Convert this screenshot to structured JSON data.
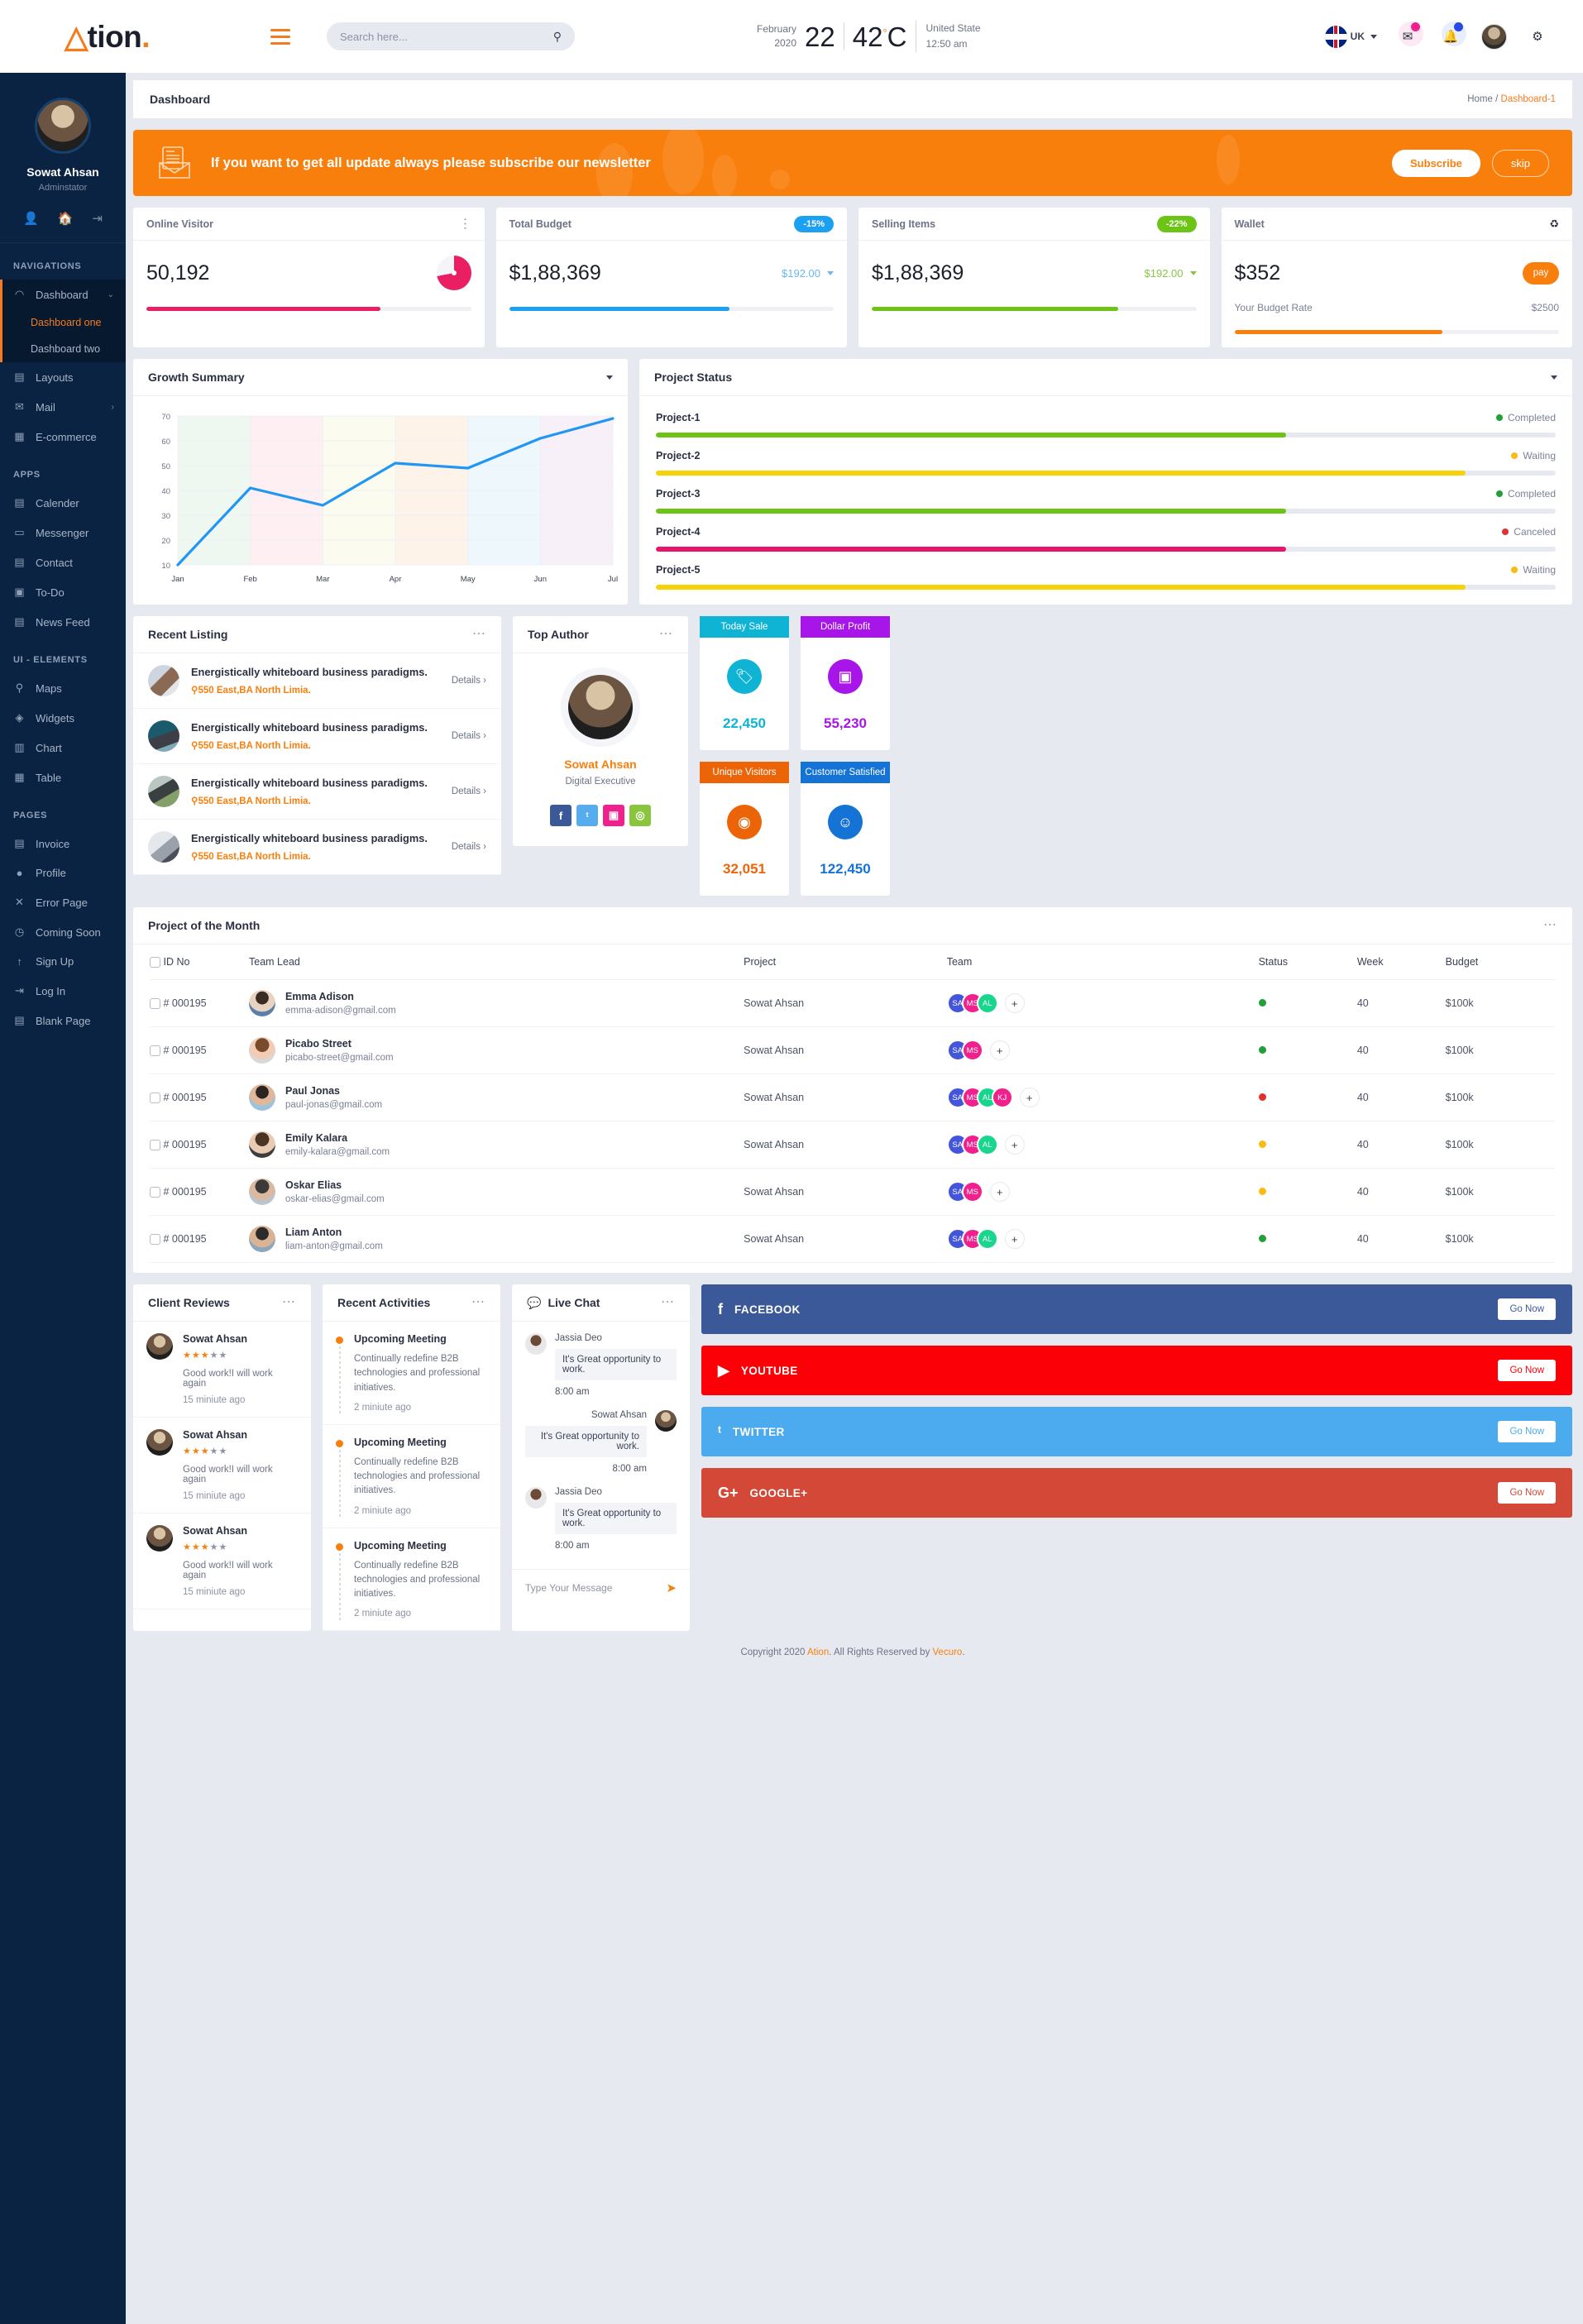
{
  "brand": {
    "mark": "A",
    "name": "tion",
    "dot": "."
  },
  "search": {
    "placeholder": "Search here...",
    "value": "",
    "icon": "search-icon"
  },
  "weather": {
    "month": "February",
    "year": "2020",
    "day": "22",
    "temp": "42",
    "unit": "C",
    "country": "United State",
    "time": "12:50 am"
  },
  "topbar": {
    "lang": "UK",
    "flag": "uk-flag-icon",
    "mail_icon": "mail-icon",
    "bell_icon": "bell-icon",
    "gear_icon": "gear-icon"
  },
  "profile": {
    "name": "Sowat Ahsan",
    "role": "Adminstator",
    "actions": [
      "user-icon",
      "home-icon",
      "logout-icon"
    ]
  },
  "sidebar": {
    "sections": [
      {
        "label": "NAVIGATIONS",
        "items": [
          {
            "label": "Dashboard",
            "icon": "speedometer-icon",
            "expandable": true,
            "open": true,
            "children": [
              {
                "label": "Dashboard one",
                "active": true
              },
              {
                "label": "Dashboard two",
                "active": false
              }
            ]
          },
          {
            "label": "Layouts",
            "icon": "grid-icon",
            "expandable": false
          },
          {
            "label": "Mail",
            "icon": "envelope-icon",
            "expandable": true
          },
          {
            "label": "E-commerce",
            "icon": "cart-icon",
            "expandable": false
          }
        ]
      },
      {
        "label": "APPS",
        "items": [
          {
            "label": "Calender",
            "icon": "calendar-icon"
          },
          {
            "label": "Messenger",
            "icon": "chat-icon"
          },
          {
            "label": "Contact",
            "icon": "contact-icon"
          },
          {
            "label": "To-Do",
            "icon": "todo-icon"
          },
          {
            "label": "News Feed",
            "icon": "news-icon"
          }
        ]
      },
      {
        "label": "UI - ELEMENTS",
        "items": [
          {
            "label": "Maps",
            "icon": "map-pin-icon"
          },
          {
            "label": "Widgets",
            "icon": "widget-icon"
          },
          {
            "label": "Chart",
            "icon": "chart-icon"
          },
          {
            "label": "Table",
            "icon": "table-icon"
          }
        ]
      },
      {
        "label": "PAGES",
        "items": [
          {
            "label": "Invoice",
            "icon": "invoice-icon"
          },
          {
            "label": "Profile",
            "icon": "person-icon"
          },
          {
            "label": "Error Page",
            "icon": "x-icon"
          },
          {
            "label": "Coming Soon",
            "icon": "clock-icon"
          },
          {
            "label": "Sign Up",
            "icon": "signup-icon"
          },
          {
            "label": "Log In",
            "icon": "login-icon"
          },
          {
            "label": "Blank Page",
            "icon": "page-icon"
          }
        ]
      }
    ]
  },
  "page": {
    "title": "Dashboard",
    "crumb_home": "Home",
    "crumb_sep": "/",
    "crumb_current": "Dashboard-1"
  },
  "banner": {
    "icon": "newsletter-envelope-icon",
    "text": "If you want to get all update always please subscribe our newsletter",
    "subscribe": "Subscribe",
    "skip": "skip",
    "color": "#f97f0d"
  },
  "stats": [
    {
      "title": "Online Visitor",
      "value": "50,192",
      "menu_icon": "kebab-menu-icon",
      "badge": null,
      "sub": null,
      "bar_pct": 72,
      "color": "#e91e63",
      "visual": "pie"
    },
    {
      "title": "Total Budget",
      "value": "$1,88,369",
      "badge": "-15%",
      "badge_color": "#1ca0f2",
      "sub": "$192.00",
      "sub_color": "#6ab7f5",
      "bar_pct": 68,
      "color": "#1ca0f2",
      "visual": "caret"
    },
    {
      "title": "Selling Items",
      "value": "$1,88,369",
      "badge": "-22%",
      "badge_color": "#6cc417",
      "sub": "$192.00",
      "sub_color": "#8bc34a",
      "bar_pct": 76,
      "color": "#6cc417",
      "visual": "caret"
    },
    {
      "title": "Wallet",
      "value": "$352",
      "menu_icon": "recycle-icon",
      "pay_label": "pay",
      "rate_label": "Your Budget Rate",
      "rate_value": "$2500",
      "bar_pct": 64,
      "color": "#f97f0d",
      "visual": "pay"
    }
  ],
  "chart_data": {
    "type": "line",
    "title": "Growth Summary",
    "x": [
      "Jan",
      "Feb",
      "Mar",
      "Apr",
      "May",
      "Jun",
      "Jul"
    ],
    "values": [
      10,
      41,
      34,
      51,
      49,
      61,
      69
    ],
    "ylim": [
      10,
      70
    ],
    "yticks": [
      10,
      20,
      30,
      40,
      50,
      60,
      70
    ],
    "xlabel": "",
    "ylabel": "",
    "line_color": "#2196f3",
    "grid": true,
    "legend": "none",
    "band_colors": [
      "#eef8f1",
      "#fdeff2",
      "#fbfbef",
      "#fdf3e9",
      "#eef7fb",
      "#f8f0f8"
    ]
  },
  "project_status": {
    "title": "Project Status",
    "items": [
      {
        "name": "Project-1",
        "status": "Completed",
        "color": "#6cc417",
        "dot": "#21a03a",
        "pct": 70
      },
      {
        "name": "Project-2",
        "status": "Waiting",
        "color": "#f6d307",
        "dot": "#f9bc13",
        "pct": 90
      },
      {
        "name": "Project-3",
        "status": "Completed",
        "color": "#6cc417",
        "dot": "#21a03a",
        "pct": 70
      },
      {
        "name": "Project-4",
        "status": "Canceled",
        "color": "#e9156b",
        "dot": "#e03131",
        "pct": 70
      },
      {
        "name": "Project-5",
        "status": "Waiting",
        "color": "#f6d307",
        "dot": "#f9bc13",
        "pct": 90
      }
    ]
  },
  "recent_listing": {
    "title": "Recent Listing",
    "menu_icon": "kebab-menu-icon",
    "items": [
      {
        "title": "Energistically whiteboard business paradigms.",
        "location": "550 East,BA North Limia.",
        "details": "Details",
        "thumb": "t1"
      },
      {
        "title": "Energistically whiteboard business paradigms.",
        "location": "550 East,BA North Limia.",
        "details": "Details",
        "thumb": "t2"
      },
      {
        "title": "Energistically whiteboard business paradigms.",
        "location": "550 East,BA North Limia.",
        "details": "Details",
        "thumb": "t3"
      },
      {
        "title": "Energistically whiteboard business paradigms.",
        "location": "550 East,BA North Limia.",
        "details": "Details",
        "thumb": "t4"
      }
    ]
  },
  "top_author": {
    "title": "Top Author",
    "menu_icon": "kebab-menu-icon",
    "name": "Sowat Ahsan",
    "role": "Digital Executive",
    "socials": [
      {
        "name": "facebook-icon",
        "glyph": "f",
        "color": "#3b5998"
      },
      {
        "name": "twitter-icon",
        "glyph": "ᵗ",
        "color": "#55acee"
      },
      {
        "name": "instagram-icon",
        "glyph": "▣",
        "color": "#f0208c"
      },
      {
        "name": "dribbble-icon",
        "glyph": "◎",
        "color": "#8ac53e"
      }
    ]
  },
  "tiles": [
    {
      "label": "Today Sale",
      "value": "22,450",
      "color": "#0fb4d4",
      "icon": "tag-icon"
    },
    {
      "label": "Dollar Profit",
      "value": "55,230",
      "color": "#a715e8",
      "icon": "money-icon"
    },
    {
      "label": "Unique Visitors",
      "value": "32,051",
      "color": "#ec6408",
      "icon": "eye-icon"
    },
    {
      "label": "Customer Satisfied",
      "value": "122,450",
      "color": "#1573d6",
      "icon": "smiley-icon"
    }
  ],
  "project_month": {
    "title": "Project of the Month",
    "menu_icon": "kebab-menu-icon",
    "columns": [
      "ID No",
      "Team Lead",
      "Project",
      "Team",
      "Status",
      "Week",
      "Budget"
    ],
    "rows": [
      {
        "id": "# 000195",
        "name": "Emma Adison",
        "email": "emma-adison@gmail.com",
        "project": "Sowat Ahsan",
        "team": [
          {
            "t": "SA",
            "c": "#4355db"
          },
          {
            "t": "MS",
            "c": "#f0208c"
          },
          {
            "t": "AL",
            "c": "#18d68d"
          }
        ],
        "status_color": "#21a03a",
        "week": "40",
        "budget": "$100k",
        "pic": "p1"
      },
      {
        "id": "# 000195",
        "name": "Picabo Street",
        "email": "picabo-street@gmail.com",
        "project": "Sowat Ahsan",
        "team": [
          {
            "t": "SA",
            "c": "#4355db"
          },
          {
            "t": "MS",
            "c": "#f0208c"
          }
        ],
        "status_color": "#21a03a",
        "week": "40",
        "budget": "$100k",
        "pic": "p2"
      },
      {
        "id": "# 000195",
        "name": "Paul Jonas",
        "email": "paul-jonas@gmail.com",
        "project": "Sowat Ahsan",
        "team": [
          {
            "t": "SA",
            "c": "#4355db"
          },
          {
            "t": "MS",
            "c": "#f0208c"
          },
          {
            "t": "AL",
            "c": "#18d68d"
          },
          {
            "t": "KJ",
            "c": "#f0208c"
          }
        ],
        "status_color": "#e03131",
        "week": "40",
        "budget": "$100k",
        "pic": "p3"
      },
      {
        "id": "# 000195",
        "name": "Emily Kalara",
        "email": "emily-kalara@gmail.com",
        "project": "Sowat Ahsan",
        "team": [
          {
            "t": "SA",
            "c": "#4355db"
          },
          {
            "t": "MS",
            "c": "#f0208c"
          },
          {
            "t": "AL",
            "c": "#18d68d"
          }
        ],
        "status_color": "#f9bc13",
        "week": "40",
        "budget": "$100k",
        "pic": "p4"
      },
      {
        "id": "# 000195",
        "name": "Oskar Elias",
        "email": "oskar-elias@gmail.com",
        "project": "Sowat Ahsan",
        "team": [
          {
            "t": "SA",
            "c": "#4355db"
          },
          {
            "t": "MS",
            "c": "#f0208c"
          }
        ],
        "status_color": "#f9bc13",
        "week": "40",
        "budget": "$100k",
        "pic": "p5"
      },
      {
        "id": "# 000195",
        "name": "Liam Anton",
        "email": "liam-anton@gmail.com",
        "project": "Sowat Ahsan",
        "team": [
          {
            "t": "SA",
            "c": "#4355db"
          },
          {
            "t": "MS",
            "c": "#f0208c"
          },
          {
            "t": "AL",
            "c": "#18d68d"
          }
        ],
        "status_color": "#21a03a",
        "week": "40",
        "budget": "$100k",
        "pic": "p6"
      }
    ]
  },
  "client_reviews": {
    "title": "Client Reviews",
    "menu_icon": "kebab-menu-icon",
    "items": [
      {
        "name": "Sowat Ahsan",
        "stars": 3,
        "max_stars": 5,
        "text": "Good work!I will work again",
        "time": "15 miniute ago"
      },
      {
        "name": "Sowat Ahsan",
        "stars": 3,
        "max_stars": 5,
        "text": "Good work!I will work again",
        "time": "15 miniute ago"
      },
      {
        "name": "Sowat Ahsan",
        "stars": 3,
        "max_stars": 5,
        "text": "Good work!I will work again",
        "time": "15 miniute ago"
      }
    ]
  },
  "recent_activities": {
    "title": "Recent Activities",
    "menu_icon": "kebab-menu-icon",
    "items": [
      {
        "title": "Upcoming Meeting",
        "text": "Continually redefine B2B technologies and professional initiatives.",
        "time": "2 miniute ago"
      },
      {
        "title": "Upcoming Meeting",
        "text": "Continually redefine B2B technologies and professional initiatives.",
        "time": "2 miniute ago"
      },
      {
        "title": "Upcoming Meeting",
        "text": "Continually redefine B2B technologies and professional initiatives.",
        "time": "2 miniute ago"
      }
    ]
  },
  "live_chat": {
    "title": "Live Chat",
    "icon": "chat-bubble-icon",
    "menu_icon": "kebab-menu-icon",
    "messages": [
      {
        "name": "Jassia Deo",
        "text": "It's Great opportunity to work.",
        "time": "8:00 am",
        "side": "them"
      },
      {
        "name": "Sowat Ahsan",
        "text": "It's Great opportunity to work.",
        "time": "8:00 am",
        "side": "me"
      },
      {
        "name": "Jassia Deo",
        "text": "It's Great opportunity to work.",
        "time": "8:00 am",
        "side": "them"
      }
    ],
    "input_placeholder": "Type Your Message",
    "send_icon": "send-icon"
  },
  "social_buttons": [
    {
      "label": "FACEBOOK",
      "cta": "Go Now",
      "color": "#3b5998",
      "icon": "facebook-icon",
      "glyph": "f"
    },
    {
      "label": "YOUTUBE",
      "cta": "Go Now",
      "color": "#fb0007",
      "icon": "youtube-icon",
      "glyph": "▶"
    },
    {
      "label": "TWITTER",
      "cta": "Go Now",
      "color": "#4cabee",
      "icon": "twitter-icon",
      "glyph": "ᵗ"
    },
    {
      "label": "GOOGLE+",
      "cta": "Go Now",
      "color": "#d34836",
      "icon": "googleplus-icon",
      "glyph": "G+"
    }
  ],
  "footer": {
    "prefix": "Copyright 2020 ",
    "brand": "Ation",
    "middle": ". All Rights Reserved by ",
    "vendor": "Vecuro",
    "suffix": "."
  }
}
